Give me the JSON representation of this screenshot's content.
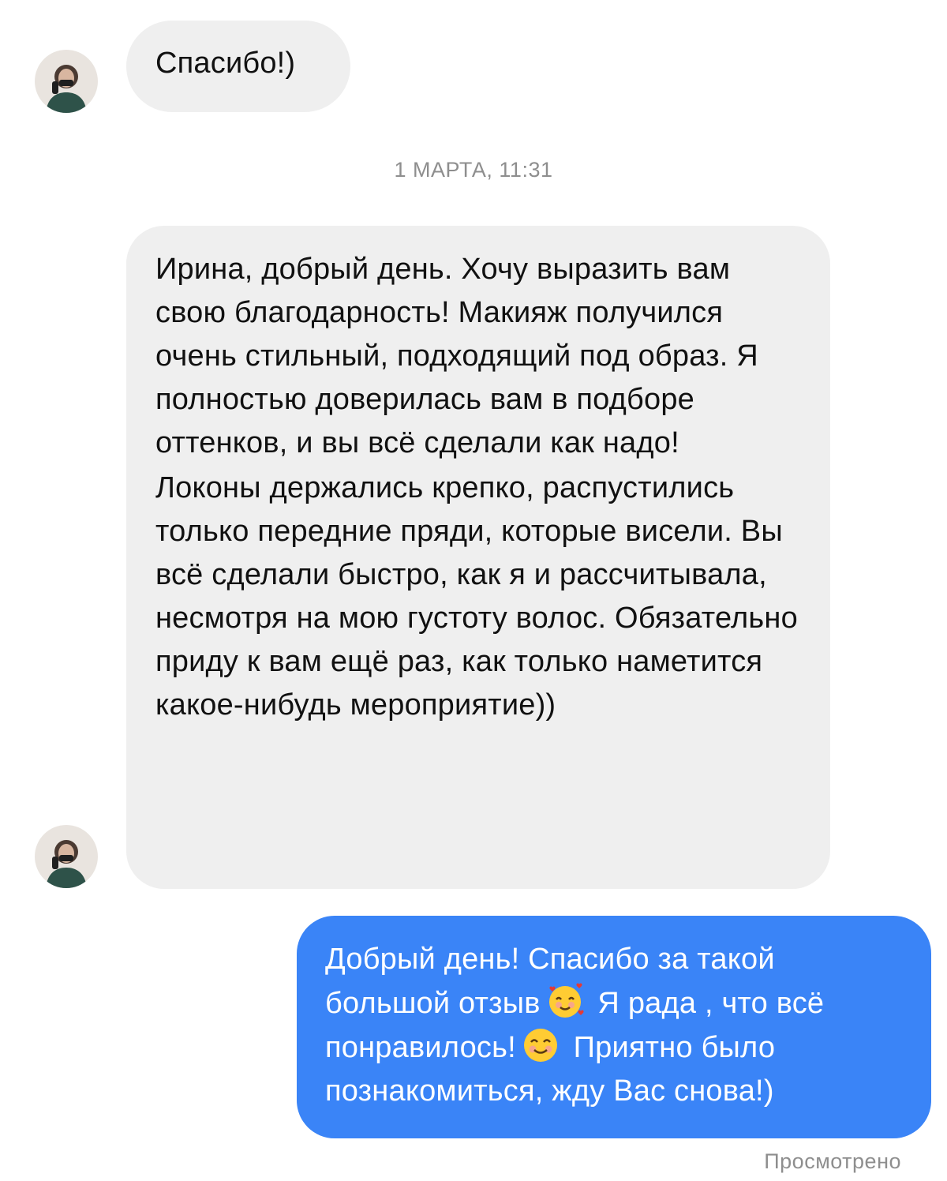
{
  "chat": {
    "messages": [
      {
        "direction": "incoming",
        "paragraphs": [
          "Спасибо!)"
        ],
        "avatar": "contact-avatar"
      },
      {
        "direction": "incoming",
        "paragraphs": [
          "Ирина, добрый день. Хочу выразить вам свою благодарность! Макияж получился очень стильный, подходящий под образ. Я полностью доверилась вам в подборе оттенков, и вы всё сделали как надо!",
          "Локоны держались крепко, распустились только передние пряди, которые висели. Вы всё сделали быстро, как я и рассчитывала, несмотря на мою густоту волос. Обязательно приду к вам ещё раз, как только наметится какое-нибудь мероприятие))"
        ],
        "avatar": "contact-avatar"
      },
      {
        "direction": "outgoing",
        "parts": {
          "p1": "Добрый день! Спасибо за такой большой отзыв",
          "emoji1": "smiling-face-with-hearts-icon",
          "p2": "Я рада , что всё понравилось!",
          "emoji2": "smiling-face-icon",
          "p3": "Приятно было познакомиться, жду Вас снова!)"
        }
      }
    ],
    "timestamp": "1 МАРТА, 11:31",
    "seen_status": "Просмотрено"
  },
  "colors": {
    "incoming_bubble": "#efefef",
    "outgoing_bubble": "#3a84f7",
    "meta_text": "#8e8e8e"
  }
}
